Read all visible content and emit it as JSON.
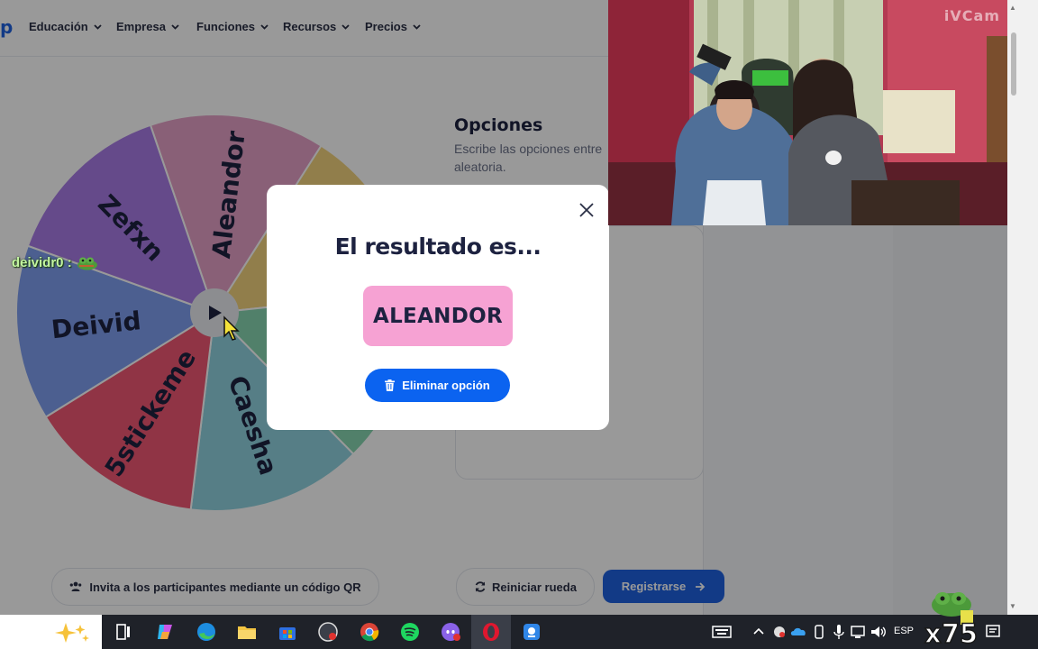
{
  "nav": {
    "logo_fragment": "p",
    "items": [
      "Educación",
      "Empresa",
      "Funciones",
      "Recursos",
      "Precios"
    ]
  },
  "wheel": {
    "segments": [
      {
        "label": "Aleandor",
        "color": "#e5a0c7"
      },
      {
        "label": "",
        "color": "#f2d37e"
      },
      {
        "label": "",
        "color": "#87d6b1"
      },
      {
        "label": "Caesha",
        "color": "#8fd3df"
      },
      {
        "label": "5stickeme",
        "color": "#f05873"
      },
      {
        "label": "Deivid",
        "color": "#7f9ff0"
      },
      {
        "label": "Zefxn",
        "color": "#a87ce6"
      }
    ]
  },
  "options": {
    "title": "Opciones",
    "subtitle": "Escribe las opciones entre aleatoria."
  },
  "buttons": {
    "qr": "Invita a los participantes mediante un código QR",
    "reset": "Reiniciar rueda",
    "register": "Registrarse"
  },
  "modal": {
    "title": "El resultado es...",
    "result": "ALEANDOR",
    "delete_label": "Eliminar opción"
  },
  "stream": {
    "webcam_label": "iVCam",
    "chat_user": "deividr0 :",
    "badge": "x75"
  },
  "taskbar": {
    "lang": "ESP"
  },
  "colors": {
    "brand_blue": "#1f62e0",
    "result_pink": "#f6a2d3",
    "delete_blue": "#0b63f0"
  }
}
